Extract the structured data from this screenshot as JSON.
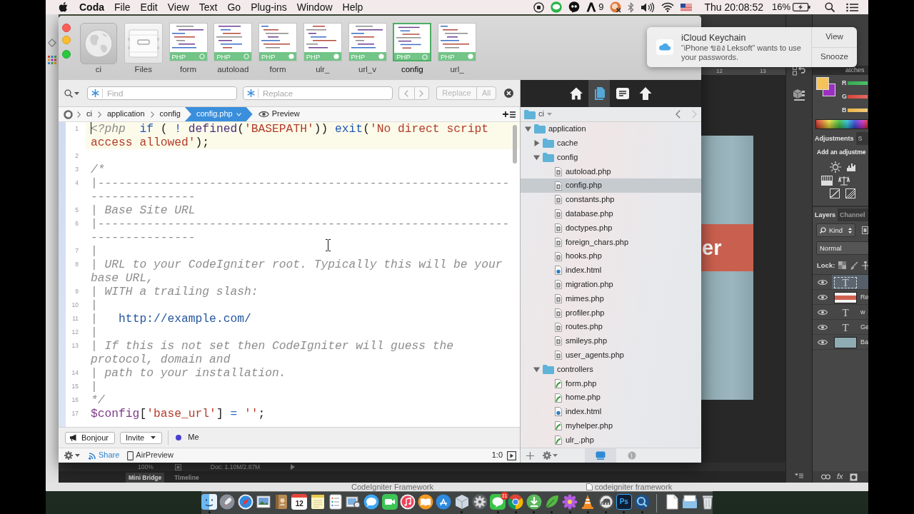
{
  "menu_bar": {
    "app": "Coda",
    "items": [
      "File",
      "Edit",
      "View",
      "Text",
      "Go",
      "Plug-ins",
      "Window",
      "Help"
    ],
    "adobe_count": "9",
    "clock": "Thu 20:08:52",
    "battery": "16%"
  },
  "coda": {
    "tabs": [
      {
        "label": "ci",
        "kind": "site",
        "selected": false
      },
      {
        "label": "Files",
        "kind": "files",
        "selected": false
      },
      {
        "label": "form",
        "kind": "php",
        "type": "PHP",
        "modified": false,
        "selected": false
      },
      {
        "label": "autoload",
        "kind": "php",
        "type": "PHP",
        "modified": false,
        "selected": false
      },
      {
        "label": "form",
        "kind": "php",
        "type": "PHP",
        "modified": true,
        "selected": false
      },
      {
        "label": "ulr_",
        "kind": "php",
        "type": "PHP",
        "modified": true,
        "selected": false
      },
      {
        "label": "url_v",
        "kind": "php",
        "type": "PHP",
        "modified": true,
        "selected": false
      },
      {
        "label": "config",
        "kind": "php",
        "type": "PHP",
        "modified": false,
        "selected": true
      },
      {
        "label": "url_",
        "kind": "php",
        "type": "PHP",
        "modified": true,
        "selected": false
      }
    ],
    "find_bar": {
      "find_placeholder": "Find",
      "replace_placeholder": "Replace",
      "buttons": [
        {
          "kind": "replace",
          "label": "Replace",
          "disabled": true
        },
        {
          "kind": "all",
          "label": "All",
          "disabled": true
        }
      ]
    },
    "path": [
      "ci",
      "application",
      "config"
    ],
    "current_file": "config.php",
    "preview": "Preview",
    "code": [
      {
        "number": "1",
        "current": true,
        "tokens": [
          {
            "kind": "tag",
            "text": "<?php"
          },
          {
            "kind": "keyword",
            "text": "  if"
          },
          {
            "kind": "plain",
            "text": " ( "
          },
          {
            "kind": "keyword",
            "text": "!"
          },
          {
            "kind": "function",
            "text": " defined"
          },
          {
            "kind": "plain",
            "text": "("
          },
          {
            "kind": "string",
            "text": "'BASEPATH'"
          },
          {
            "kind": "plain",
            "text": ")) "
          },
          {
            "kind": "keyword",
            "text": "exit"
          },
          {
            "kind": "plain",
            "text": "("
          },
          {
            "kind": "string",
            "text": "'No direct script access allowed'"
          },
          {
            "kind": "plain",
            "text": ");"
          }
        ]
      },
      {
        "number": "2",
        "current": false
      },
      {
        "number": "3",
        "current": false,
        "tokens": [
          {
            "kind": "comment",
            "text": "/*"
          }
        ]
      },
      {
        "number": "4",
        "current": false,
        "tokens": [
          {
            "kind": "comment",
            "text": "|--------------------------------------------------------------------------"
          }
        ]
      },
      {
        "number": "5",
        "current": false,
        "tokens": [
          {
            "kind": "comment",
            "text": "| Base Site URL"
          }
        ]
      },
      {
        "number": "6",
        "current": false,
        "tokens": [
          {
            "kind": "comment",
            "text": "|--------------------------------------------------------------------------"
          }
        ]
      },
      {
        "number": "7",
        "current": false,
        "tokens": [
          {
            "kind": "comment",
            "text": "|"
          }
        ]
      },
      {
        "number": "8",
        "current": false,
        "tokens": [
          {
            "kind": "comment",
            "text": "| URL to your CodeIgniter root. Typically this will be your base URL,"
          }
        ]
      },
      {
        "number": "9",
        "current": false,
        "tokens": [
          {
            "kind": "comment",
            "text": "| WITH a trailing slash:"
          }
        ]
      },
      {
        "number": "10",
        "current": false,
        "tokens": [
          {
            "kind": "comment",
            "text": "|"
          }
        ]
      },
      {
        "number": "11",
        "current": false,
        "tokens": [
          {
            "kind": "comment",
            "text": "|   "
          },
          {
            "kind": "url",
            "text": "http://example.com/"
          }
        ]
      },
      {
        "number": "12",
        "current": false,
        "tokens": [
          {
            "kind": "comment",
            "text": "|"
          }
        ]
      },
      {
        "number": "13",
        "current": false,
        "tokens": [
          {
            "kind": "comment",
            "text": "| If this is not set then CodeIgniter will guess the protocol, domain and"
          }
        ]
      },
      {
        "number": "14",
        "current": false,
        "tokens": [
          {
            "kind": "comment",
            "text": "| path to your installation."
          }
        ]
      },
      {
        "number": "15",
        "current": false,
        "tokens": [
          {
            "kind": "comment",
            "text": "|"
          }
        ]
      },
      {
        "number": "16",
        "current": false,
        "tokens": [
          {
            "kind": "comment",
            "text": "*/"
          }
        ]
      },
      {
        "number": "17",
        "current": false,
        "tokens": [
          {
            "kind": "variable",
            "text": "$config"
          },
          {
            "kind": "plain",
            "text": "["
          },
          {
            "kind": "string",
            "text": "'base_url'"
          },
          {
            "kind": "plain",
            "text": "] "
          },
          {
            "kind": "operator",
            "text": "="
          },
          {
            "kind": "string",
            "text": " ''"
          },
          {
            "kind": "plain",
            "text": ";"
          }
        ]
      }
    ],
    "collaboration": {
      "bonjour": "Bonjour",
      "invite": "Invite",
      "user": "Me"
    },
    "status_bar": {
      "share": "Share",
      "airpreview": "AirPreview",
      "position": "1:0"
    },
    "sidebar": {
      "toolbar": [
        {
          "kind": "home",
          "selected": false
        },
        {
          "kind": "files",
          "selected": true
        },
        {
          "kind": "outline",
          "selected": false
        },
        {
          "kind": "up",
          "selected": false
        }
      ],
      "site": "ci",
      "nav": [
        {
          "kind": "back",
          "disabled": false
        },
        {
          "kind": "forward",
          "disabled": true
        }
      ],
      "tree": [
        {
          "label": "application",
          "kind": "folder",
          "expanded": true,
          "selected": false,
          "children": [
            {
              "label": "cache",
              "kind": "folder",
              "expanded": false,
              "selected": false
            },
            {
              "label": "config",
              "kind": "folder",
              "expanded": true,
              "selected": false,
              "children": [
                {
                  "label": "autoload.php",
                  "kind": "php",
                  "selected": false
                },
                {
                  "label": "config.php",
                  "kind": "php",
                  "selected": true
                },
                {
                  "label": "constants.php",
                  "kind": "php",
                  "selected": false
                },
                {
                  "label": "database.php",
                  "kind": "php",
                  "selected": false
                },
                {
                  "label": "doctypes.php",
                  "kind": "php",
                  "selected": false
                },
                {
                  "label": "foreign_chars.php",
                  "kind": "php",
                  "selected": false
                },
                {
                  "label": "hooks.php",
                  "kind": "php",
                  "selected": false
                },
                {
                  "label": "index.html",
                  "kind": "html",
                  "selected": false
                },
                {
                  "label": "migration.php",
                  "kind": "php",
                  "selected": false
                },
                {
                  "label": "mimes.php",
                  "kind": "php",
                  "selected": false
                },
                {
                  "label": "profiler.php",
                  "kind": "php",
                  "selected": false
                },
                {
                  "label": "routes.php",
                  "kind": "php",
                  "selected": false
                },
                {
                  "label": "smileys.php",
                  "kind": "php",
                  "selected": false
                },
                {
                  "label": "user_agents.php",
                  "kind": "php",
                  "selected": false
                }
              ]
            },
            {
              "label": "controllers",
              "kind": "folder",
              "expanded": true,
              "selected": false,
              "children": [
                {
                  "label": "form.php",
                  "kind": "script",
                  "selected": false
                },
                {
                  "label": "home.php",
                  "kind": "script",
                  "selected": false
                },
                {
                  "label": "index.html",
                  "kind": "html",
                  "selected": false
                },
                {
                  "label": "myhelper.php",
                  "kind": "script",
                  "selected": false
                },
                {
                  "label": "ulr_.php",
                  "kind": "script",
                  "selected": false
                }
              ]
            }
          ]
        }
      ],
      "views": [
        {
          "kind": "local",
          "selected": true
        },
        {
          "kind": "remote",
          "selected": false
        }
      ]
    }
  },
  "notification": {
    "title": "iCloud Keychain",
    "message": "“iPhone ของ Leksoft” wants to use your passwords.",
    "actions": [
      "View",
      "Snooze"
    ]
  },
  "photoshop": {
    "ruler": [
      "12",
      "13"
    ],
    "canvas_text": "er",
    "swatches_tab": "atches",
    "channels": [
      "R",
      "G",
      "B"
    ],
    "adjustments": {
      "tabs": [
        {
          "label": "Adjustments",
          "selected": true
        },
        {
          "label": "S",
          "selected": false
        }
      ],
      "hint": "Add an adjustme"
    },
    "layers_panel": {
      "tabs": [
        {
          "label": "Layers",
          "selected": true
        },
        {
          "label": "Channel",
          "selected": false
        }
      ],
      "filter": "Kind",
      "blend_mode": "Normal",
      "lock": "Lock:",
      "layers": [
        {
          "kind": "text",
          "glyph": "T",
          "selected": true,
          "visible": true
        },
        {
          "kind": "banner",
          "name": "Re",
          "selected": false,
          "visible": true
        },
        {
          "kind": "text",
          "glyph": "T",
          "name": "w",
          "selected": false,
          "visible": true
        },
        {
          "kind": "text",
          "glyph": "T",
          "name": "Ge",
          "selected": false,
          "visible": true
        },
        {
          "kind": "fill",
          "name": "Ba",
          "selected": false,
          "visible": true
        }
      ]
    },
    "effects": "fx",
    "zoom": "100%",
    "doc_size": "Doc: 1.10M/2.87M",
    "bottom_tabs": [
      {
        "label": "Mini Bridge",
        "selected": true
      },
      {
        "label": "Timeline",
        "selected": false
      }
    ]
  },
  "background_window": {
    "title": "CodeIgniter Framework",
    "tab": "codeigniter framework"
  },
  "dock": {
    "apps": [
      {
        "kind": "face",
        "running": true
      },
      {
        "kind": "rocket",
        "running": false
      },
      {
        "kind": "compass",
        "running": false
      },
      {
        "kind": "photo",
        "running": false
      },
      {
        "kind": "book",
        "running": false
      },
      {
        "kind": "calendar",
        "label": "12",
        "running": false
      },
      {
        "kind": "note",
        "running": false
      },
      {
        "kind": "checklist",
        "running": false
      },
      {
        "kind": "gallery",
        "running": false
      },
      {
        "kind": "chat",
        "running": false
      },
      {
        "kind": "camera",
        "running": false
      },
      {
        "kind": "music",
        "running": false
      },
      {
        "kind": "reader",
        "running": false
      },
      {
        "kind": "store",
        "running": false
      },
      {
        "kind": "cube",
        "running": true
      },
      {
        "kind": "gear",
        "running": false
      },
      {
        "kind": "bubble",
        "badge": "31",
        "running": true
      },
      {
        "kind": "wheel",
        "running": true
      },
      {
        "kind": "download",
        "running": true
      },
      {
        "kind": "leaf",
        "running": true
      },
      {
        "kind": "flower",
        "running": true
      },
      {
        "kind": "cone",
        "running": true
      },
      {
        "kind": "elephant",
        "running": true
      },
      {
        "kind": "editor",
        "label": "Ps",
        "running": true
      },
      {
        "kind": "magnifier",
        "running": true
      }
    ],
    "files": [
      {
        "kind": "document"
      },
      {
        "kind": "stack"
      },
      {
        "kind": "trash"
      }
    ]
  }
}
